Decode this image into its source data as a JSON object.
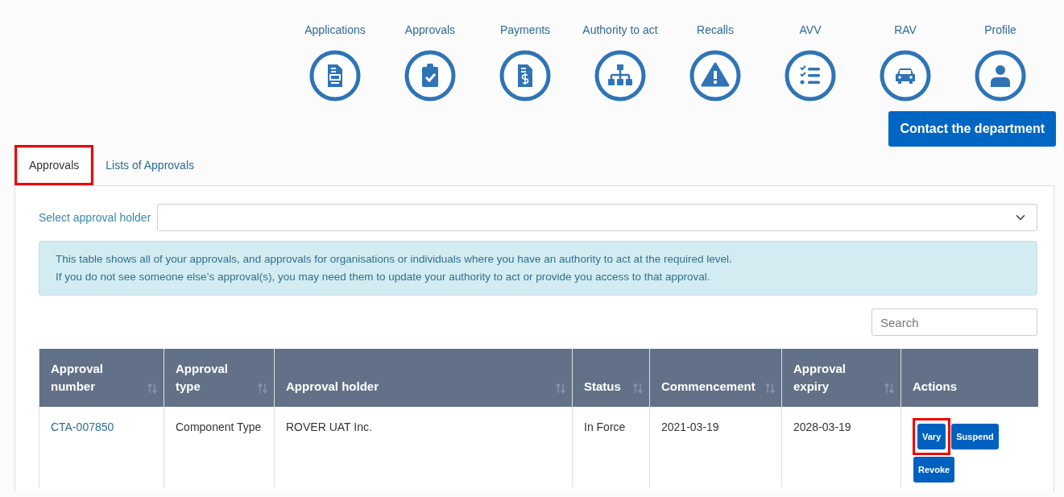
{
  "nav": [
    {
      "label": "Applications"
    },
    {
      "label": "Approvals"
    },
    {
      "label": "Payments"
    },
    {
      "label": "Authority to act"
    },
    {
      "label": "Recalls"
    },
    {
      "label": "AVV"
    },
    {
      "label": "RAV"
    },
    {
      "label": "Profile"
    }
  ],
  "contact_button": "Contact the department",
  "tabs": [
    {
      "label": "Approvals",
      "selected": true,
      "highlighted": true
    },
    {
      "label": "Lists of Approvals",
      "selected": false,
      "highlighted": false
    }
  ],
  "holder_select": {
    "label": "Select approval holder"
  },
  "info": [
    "This table shows all of your approvals, and approvals for organisations or individuals where you have an authority to act at the required level.",
    "If you do not see someone else’s approval(s), you may need them to update your authority to act or provide you access to that approval."
  ],
  "search": {
    "placeholder": "Search"
  },
  "table": {
    "columns": [
      {
        "label": "Approval number",
        "sortable": true
      },
      {
        "label": "Approval type",
        "sortable": true
      },
      {
        "label": "Approval holder",
        "sortable": true
      },
      {
        "label": "Status",
        "sortable": true
      },
      {
        "label": "Commencement",
        "sortable": true
      },
      {
        "label": "Approval expiry",
        "sortable": true
      },
      {
        "label": "Actions",
        "sortable": false
      }
    ],
    "rows": [
      {
        "number": "CTA-007850",
        "type": "Component Type",
        "holder": "ROVER UAT Inc.",
        "status": "In Force",
        "commencement": "2021-03-19",
        "expiry": "2028-03-19",
        "actions": [
          {
            "label": "Vary",
            "highlighted": true
          },
          {
            "label": "Suspend",
            "highlighted": false
          },
          {
            "label": "Revoke",
            "highlighted": false
          }
        ]
      }
    ]
  }
}
